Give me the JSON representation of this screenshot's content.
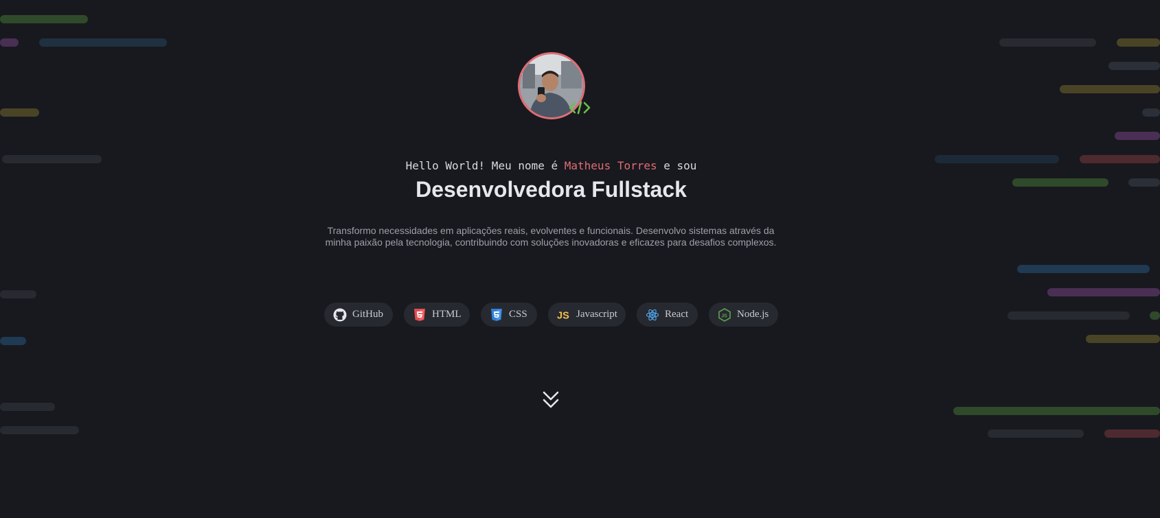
{
  "intro": {
    "prefix": "Hello World! Meu nome é ",
    "name": "Matheus Torres",
    "suffix": " e sou"
  },
  "role_title": "Desenvolvedora Fullstack",
  "description": "Transformo necessidades em aplicações reais, evolventes e funcionais. Desenvolvo sistemas através da minha paixão pela tecnologia, contribuindo com soluções inovadoras e eficazes para desafios complexos.",
  "tags": [
    {
      "label": "GitHub",
      "icon": "github-icon"
    },
    {
      "label": "HTML",
      "icon": "html5-icon"
    },
    {
      "label": "CSS",
      "icon": "css3-icon"
    },
    {
      "label": "Javascript",
      "icon": "javascript-icon"
    },
    {
      "label": "React",
      "icon": "react-icon"
    },
    {
      "label": "Node.js",
      "icon": "nodejs-icon"
    }
  ],
  "avatar": {
    "alt": "profile-photo",
    "badge_icon": "code-icon"
  },
  "scroll_icon": "double-chevron-down-icon",
  "colors": {
    "background": "#18191e",
    "accent_red": "#e06c75",
    "accent_green": "#6cbf4a",
    "html_orange": "#e44d26",
    "css_blue": "#2965f1",
    "js_yellow": "#f0db4f",
    "react_blue": "#61dafb",
    "node_green": "#539e43"
  }
}
